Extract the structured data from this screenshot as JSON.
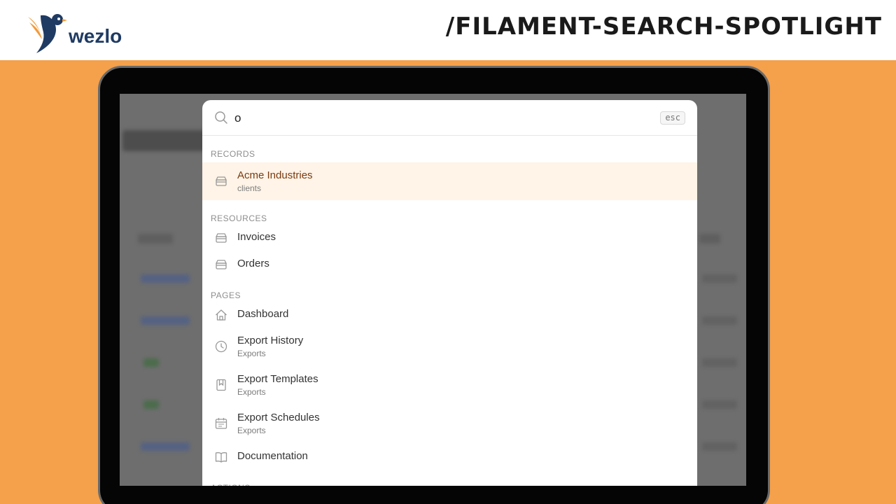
{
  "brand": {
    "logo_text": "wezlo",
    "headline": "/FILAMENT-SEARCH-SPOTLIGHT"
  },
  "spotlight": {
    "query": "o",
    "esc_label": "esc",
    "sections": {
      "records": "RECORDS",
      "resources": "RESOURCES",
      "pages": "PAGES",
      "actions": "ACTIONS"
    },
    "records": [
      {
        "label": "Acme Industries",
        "sub": "clients",
        "icon": "archive-icon"
      }
    ],
    "resources": [
      {
        "label": "Invoices",
        "icon": "archive-icon"
      },
      {
        "label": "Orders",
        "icon": "archive-icon"
      }
    ],
    "pages": [
      {
        "label": "Dashboard",
        "icon": "home-icon"
      },
      {
        "label": "Export History",
        "sub": "Exports",
        "icon": "clock-icon"
      },
      {
        "label": "Export Templates",
        "sub": "Exports",
        "icon": "bookmark-icon"
      },
      {
        "label": "Export Schedules",
        "sub": "Exports",
        "icon": "calendar-icon"
      },
      {
        "label": "Documentation",
        "icon": "book-icon"
      }
    ]
  },
  "colors": {
    "accent_bg": "#f5a04a",
    "active_row": "#fff4e7",
    "active_text": "#7a3a0f",
    "brand_navy": "#1f3b63"
  }
}
